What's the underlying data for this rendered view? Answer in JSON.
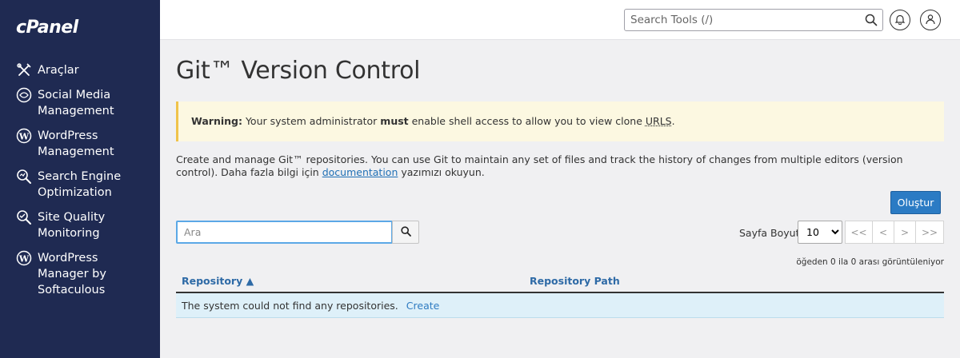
{
  "sidebar": {
    "logo": "cPanel",
    "items": [
      {
        "label": "Araçlar"
      },
      {
        "label": "Social Media Management"
      },
      {
        "label": "WordPress Management"
      },
      {
        "label": "Search Engine Optimization"
      },
      {
        "label": "Site Quality Monitoring"
      },
      {
        "label": "WordPress Manager by Softaculous"
      }
    ]
  },
  "topbar": {
    "search_placeholder": "Search Tools (/)"
  },
  "main": {
    "title": "Git™ Version Control",
    "warning": {
      "label": "Warning:",
      "text_before": " Your system administrator ",
      "bold": "must",
      "text_after": " enable shell access to allow you to view clone ",
      "abbr": "URLS",
      "period": "."
    },
    "description": {
      "text": "Create and manage Git™ repositories. You can use Git to maintain any set of files and track the history of changes from multiple editors (version control). Daha fazla bilgi için ",
      "link": "documentation",
      "after": " yazımızı okuyun."
    },
    "create_button": "Oluştur",
    "search_placeholder": "Ara",
    "page_size_label": "Sayfa Boyutu",
    "page_size_value": "10",
    "page_size_options": [
      "10"
    ],
    "pager": {
      "first": "<<",
      "prev": "<",
      "next": ">",
      "last": ">>"
    },
    "count_text": "öğeden 0 ila 0 arası görüntüleniyor",
    "table": {
      "col_repository": "Repository ▲",
      "col_path": "Repository Path",
      "empty_text": "The system could not find any repositories.",
      "empty_link": "Create"
    }
  }
}
